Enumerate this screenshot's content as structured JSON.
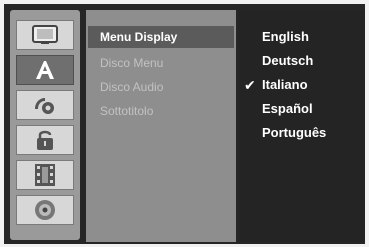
{
  "rail": {
    "items": [
      {
        "icon": "tv-icon",
        "active": false
      },
      {
        "icon": "language-icon",
        "active": true
      },
      {
        "icon": "audio-icon",
        "active": false
      },
      {
        "icon": "lock-icon",
        "active": false
      },
      {
        "icon": "film-icon",
        "active": false
      },
      {
        "icon": "disc-icon",
        "active": false
      }
    ]
  },
  "submenu": {
    "items": [
      {
        "label": "Menu Display",
        "active": true
      },
      {
        "label": "Disco Menu",
        "active": false
      },
      {
        "label": "Disco Audio",
        "active": false
      },
      {
        "label": "Sottotitolo",
        "active": false
      }
    ]
  },
  "options": {
    "items": [
      {
        "label": "English",
        "selected": false
      },
      {
        "label": "Deutsch",
        "selected": false
      },
      {
        "label": "Italiano",
        "selected": true
      },
      {
        "label": "Español",
        "selected": false
      },
      {
        "label": "Português",
        "selected": false
      }
    ],
    "check_glyph": "✔"
  },
  "colors": {
    "background": "#262626",
    "rail": "#9a9a9a",
    "rail_button": "#d7d7d7",
    "rail_button_active": "#6f6f6f",
    "submenu_panel": "#8e8e8e",
    "submenu_highlight": "#5b5b5b",
    "options_panel": "#242424",
    "text_active": "#ffffff",
    "text_disabled": "#c2c2c2"
  }
}
